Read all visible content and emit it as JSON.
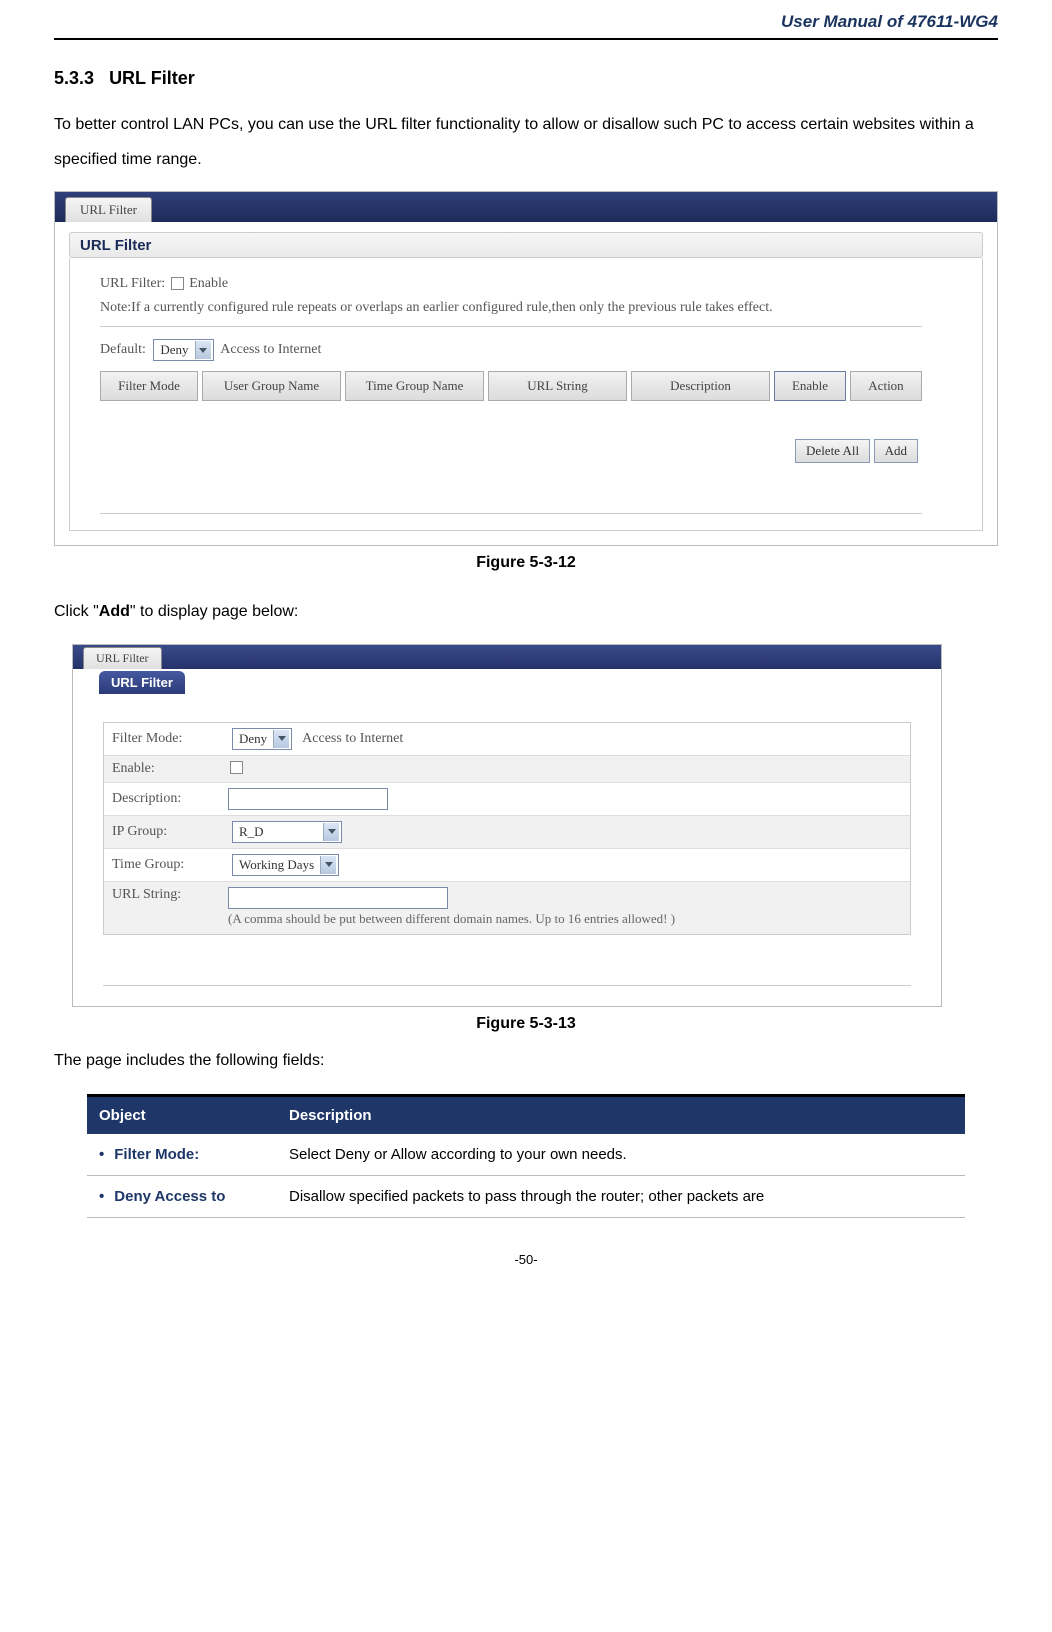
{
  "header": {
    "doc_title": "User Manual of 47611-WG4"
  },
  "section": {
    "number": "5.3.3",
    "title": "URL Filter"
  },
  "para1": "To better control LAN PCs, you can use the URL filter functionality to allow or disallow such PC to access certain websites within a specified time range.",
  "fig1": {
    "tab": "URL Filter",
    "panel_title": "URL Filter",
    "url_filter_label": "URL Filter:",
    "enable_text": "Enable",
    "note": "Note:If a currently configured rule repeats or overlaps an earlier configured rule,then only the previous rule takes effect.",
    "default_label": "Default:",
    "default_value": "Deny",
    "default_suffix": "Access to Internet",
    "cols": {
      "c1": "Filter Mode",
      "c2": "User Group Name",
      "c3": "Time Group Name",
      "c4": "URL String",
      "c5": "Description",
      "c6": "Enable",
      "c7": "Action"
    },
    "btn_delete": "Delete All",
    "btn_add": "Add",
    "caption": "Figure 5-3-12"
  },
  "click_add": {
    "pre": "Click \"",
    "bold": "Add",
    "post": "\" to display page below:"
  },
  "fig2": {
    "tab": "URL Filter",
    "panel_title": "URL Filter",
    "rows": {
      "filter_mode_label": "Filter Mode:",
      "filter_mode_value": "Deny",
      "filter_mode_suffix": "Access to Internet",
      "enable_label": "Enable:",
      "description_label": "Description:",
      "ip_group_label": "IP Group:",
      "ip_group_value": "R_D",
      "time_group_label": "Time Group:",
      "time_group_value": "Working Days",
      "url_string_label": "URL String:",
      "url_note": "(A comma should be put between different domain names. Up to 16 entries allowed! )"
    },
    "caption": "Figure 5-3-13"
  },
  "para2": "The page includes the following fields:",
  "table": {
    "h1": "Object",
    "h2": "Description",
    "r1o": "Filter Mode:",
    "r1d": "Select Deny or Allow according to your own needs.",
    "r2o": "Deny Access to",
    "r2d": "Disallow specified packets to pass through the router; other packets are"
  },
  "page_num": "-50-"
}
